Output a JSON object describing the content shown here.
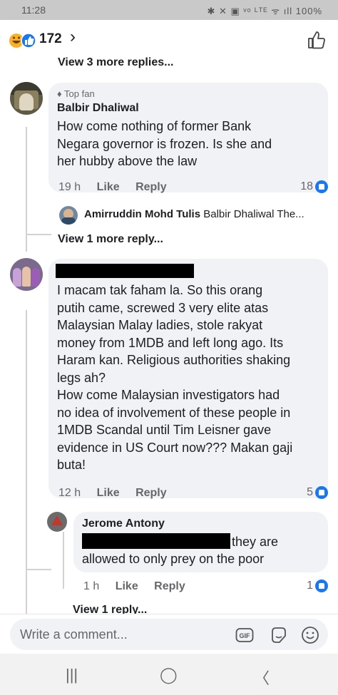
{
  "status_bar": {
    "time": "11:28",
    "indicators": "✱ ✕ ▣ ᵛᵒ ᴸᵀᴱ ᯤ ıll 100%",
    "battery_icon": "battery-icon"
  },
  "header": {
    "reaction_count": "172",
    "reaction_icons": [
      "haha-icon",
      "like-icon"
    ],
    "like_icon": "like-outline-icon"
  },
  "view_more_top": "View 3 more replies...",
  "comments": [
    {
      "badge": "Top fan",
      "author": "Balbir Dhaliwal",
      "text_lines": [
        "How come nothing of former Bank",
        "Negara governor is frozen. Is she and",
        "her hubby above the law"
      ],
      "time": "19 h",
      "like": "Like",
      "reply": "Reply",
      "reactions": "18"
    },
    {
      "author": "",
      "author_redacted": true,
      "text_lines": [
        "I macam tak faham la. So this orang",
        "putih came, screwed 3 very elite atas",
        "Malaysian Malay ladies, stole rakyat",
        "money from 1MDB and left long ago. Its",
        "Haram kan. Religious authorities shaking",
        "legs ah?",
        "How come Malaysian investigators had",
        "no idea of involvement of these people in",
        "1MDB Scandal until Tim Leisner gave",
        "evidence in US Court now???  Makan gaji",
        "buta!"
      ],
      "time": "12 h",
      "like": "Like",
      "reply": "Reply",
      "reactions": "5"
    }
  ],
  "reply_preview": {
    "author": "Amirruddin Mohd Tulis",
    "snippet": "Balbir Dhaliwal The..."
  },
  "view_more_reply_1": "View 1 more reply...",
  "reply": {
    "author": "Jerome Antony",
    "line1_visible": "they are",
    "line2": "allowed to only prey on the poor",
    "time": "1 h",
    "like": "Like",
    "reply": "Reply",
    "reactions": "1"
  },
  "view_reply_partial": "View 1 reply...",
  "composer": {
    "placeholder": "Write a comment...",
    "icons": [
      "gif-icon",
      "sticker-icon",
      "emoji-icon"
    ]
  },
  "nav": {
    "recents": "|||",
    "home": "◯",
    "back": "〈"
  },
  "colors": {
    "accent": "#1877f2",
    "bubble": "#f0f2f5",
    "meta": "#65676b"
  }
}
